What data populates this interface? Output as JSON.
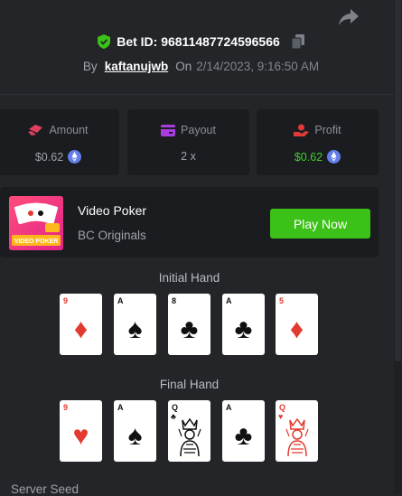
{
  "header": {
    "bet_id": "Bet ID: 96811487724596566",
    "by_label": "By",
    "username": "kaftanujwb",
    "on_label": "On",
    "date": "2/14/2023, 9:16:50 AM"
  },
  "stats": [
    {
      "label": "Amount",
      "value": "$0.62",
      "icon": "money-icon"
    },
    {
      "label": "Payout",
      "value": "2 x",
      "icon": "wallet-icon"
    },
    {
      "label": "Profit",
      "value": "$0.62",
      "icon": "profit-icon"
    }
  ],
  "game": {
    "name": "Video Poker",
    "provider": "BC Originals",
    "thumb_text": "VIDEO POKER",
    "play_label": "Play Now"
  },
  "initial_hand": {
    "title": "Initial Hand",
    "cards": [
      {
        "rank": "9",
        "suit": "♦",
        "color": "red"
      },
      {
        "rank": "A",
        "suit": "♠",
        "color": "blk"
      },
      {
        "rank": "8",
        "suit": "♣",
        "color": "blk"
      },
      {
        "rank": "A",
        "suit": "♣",
        "color": "blk"
      },
      {
        "rank": "5",
        "suit": "♦",
        "color": "red"
      }
    ]
  },
  "final_hand": {
    "title": "Final Hand",
    "cards": [
      {
        "rank": "9",
        "suit": "♥",
        "color": "red"
      },
      {
        "rank": "A",
        "suit": "♠",
        "color": "blk"
      },
      {
        "rank": "Q",
        "suit": "♣",
        "color": "blk",
        "face": true
      },
      {
        "rank": "A",
        "suit": "♣",
        "color": "blk"
      },
      {
        "rank": "Q",
        "suit": "♥",
        "color": "red",
        "face": true
      }
    ]
  },
  "server_seed_label": "Server Seed",
  "colors": {
    "accent_green": "#3bc117",
    "profit_green": "#41d12c",
    "background": "#232528",
    "panel": "#1a1c1f"
  }
}
